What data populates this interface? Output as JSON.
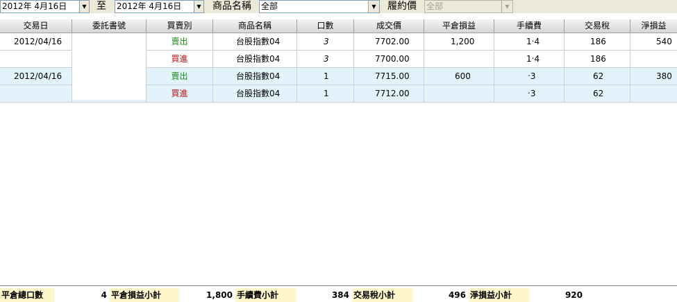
{
  "filters": {
    "date_from": "2012年  4月16日",
    "to_label": "至",
    "date_to": "2012年  4月16日",
    "product_label": "商品名稱",
    "product_value": "全部",
    "strike_label": "履約價",
    "strike_value": "全部",
    "drop_arrow": "▼"
  },
  "columns": [
    "交易日",
    "委託書號",
    "買賣別",
    "商品名稱",
    "口數",
    "成交價",
    "平倉損益",
    "手續費",
    "交易稅",
    "淨損益"
  ],
  "rows": [
    {
      "date": "2012/04/16",
      "order_no": "",
      "side": "賣出",
      "product": "台股指數04",
      "qty": "3",
      "price": "7702.00",
      "pnl": "1,200",
      "fee": "1‧4",
      "tax": "186",
      "net": "540"
    },
    {
      "date": "",
      "order_no": "",
      "side": "買進",
      "product": "台股指數04",
      "qty": "3",
      "price": "7700.00",
      "pnl": "",
      "fee": "1‧4",
      "tax": "186",
      "net": ""
    },
    {
      "date": "2012/04/16",
      "order_no": "",
      "side": "賣出",
      "product": "台股指數04",
      "qty": "1",
      "price": "7715.00",
      "pnl": "600",
      "fee": "‧3",
      "tax": "62",
      "net": "380"
    },
    {
      "date": "",
      "order_no": "",
      "side": "買進",
      "product": "台股指數04",
      "qty": "1",
      "price": "7712.00",
      "pnl": "",
      "fee": "‧3",
      "tax": "62",
      "net": ""
    }
  ],
  "footer": {
    "total_qty_label": "平倉總口數",
    "total_qty": "4",
    "pnl_subtotal_label": "平倉損益小計",
    "pnl_subtotal": "1,800",
    "fee_subtotal_label": "手續費小計",
    "fee_subtotal": "384",
    "tax_subtotal_label": "交易稅小計",
    "tax_subtotal": "496",
    "net_subtotal_label": "淨損益小計",
    "net_subtotal": "920"
  },
  "colors": {
    "sell": "#1a8a1a",
    "buy": "#c01010",
    "alt_row": "#e3f3fb",
    "footer_label_bg": "#fff6cc"
  }
}
